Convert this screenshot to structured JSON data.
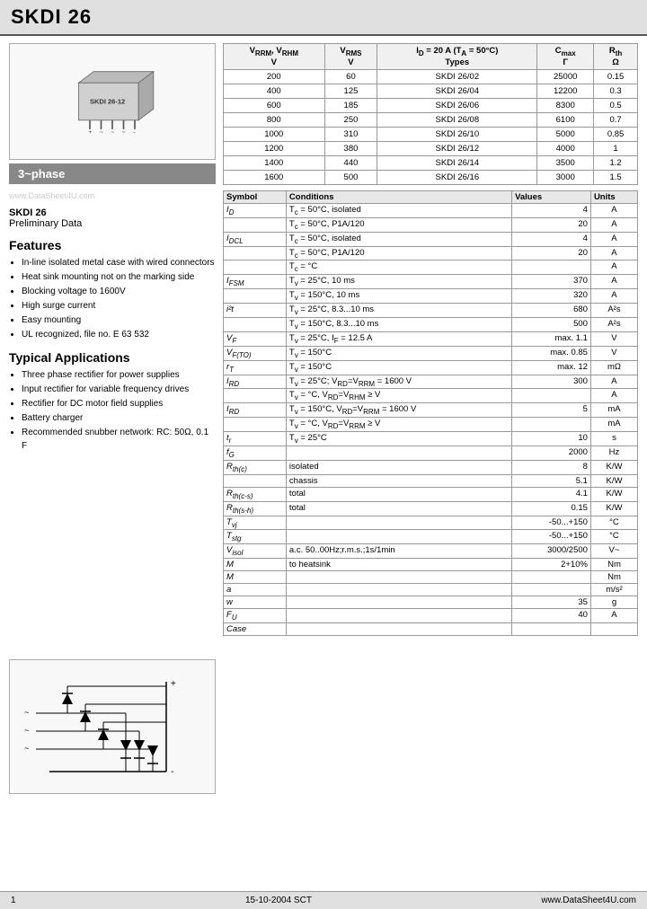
{
  "header": {
    "title": "SKDI 26"
  },
  "phase_label": "3~phase",
  "watermark": "www.DataSheet4U.com",
  "part_info": {
    "name": "SKDI 26",
    "status": "Preliminary Data"
  },
  "features": {
    "title": "Features",
    "items": [
      "In-line isolated metal case with wired connectors",
      "Heat sink mounting not on the marking side",
      "Blocking voltage to 1600V",
      "High surge current",
      "Easy mounting",
      "UL recognized, file no. E 63 532"
    ]
  },
  "applications": {
    "title": "Typical Applications",
    "items": [
      "Three phase rectifier for power supplies",
      "Input rectifier for variable frequency drives",
      "Rectifier for DC motor field supplies",
      "Battery charger",
      "Recommended snubber network: RC: 50Ω, 0.1 F"
    ]
  },
  "ratings_table": {
    "headers": [
      "V_RRM, V_RHM\nV",
      "V_RMS\nV",
      "I_D = 20 A (T_A = 50°C)\nTypes",
      "C_max\nΓ",
      "R_th\nΩ"
    ],
    "rows": [
      [
        "200",
        "60",
        "SKDI 26/02",
        "25000",
        "0.15"
      ],
      [
        "400",
        "125",
        "SKDI 26/04",
        "12200",
        "0.3"
      ],
      [
        "600",
        "185",
        "SKDI 26/06",
        "8300",
        "0.5"
      ],
      [
        "800",
        "250",
        "SKDI 26/08",
        "6100",
        "0.7"
      ],
      [
        "1000",
        "310",
        "SKDI 26/10",
        "5000",
        "0.85"
      ],
      [
        "1200",
        "380",
        "SKDI 26/12",
        "4000",
        "1"
      ],
      [
        "1400",
        "440",
        "SKDI 26/14",
        "3500",
        "1.2"
      ],
      [
        "1600",
        "500",
        "SKDI 26/16",
        "3000",
        "1.5"
      ]
    ]
  },
  "specs_table": {
    "headers": [
      "Symbol",
      "Conditions",
      "Values",
      "Units"
    ],
    "rows": [
      [
        "I_D",
        "T_c = 50°C, isolated",
        "4",
        "A"
      ],
      [
        "",
        "T_c = 50°C, P1A/120",
        "20",
        "A"
      ],
      [
        "I_DCL",
        "T_c = 50°C, isolated",
        "4",
        "A"
      ],
      [
        "",
        "T_c = 50°C, P1A/120",
        "20",
        "A"
      ],
      [
        "",
        "T_c = °C",
        "",
        "A"
      ],
      [
        "I_FSM",
        "T_v = 25°C, 10 ms",
        "370",
        "A"
      ],
      [
        "",
        "T_v = 150°C, 10 ms",
        "320",
        "A"
      ],
      [
        "i²t",
        "T_v = 25°C, 8.3...10 ms",
        "680",
        "A²s"
      ],
      [
        "",
        "T_v = 150°C, 8.3...10 ms",
        "500",
        "A²s"
      ],
      [
        "V_F",
        "T_v = 25°C, I_F = 12.5 A",
        "max. 1.1",
        "V"
      ],
      [
        "V_F(TO)",
        "T_v = 150°C",
        "max. 0.85",
        "V"
      ],
      [
        "r_T",
        "T_v = 150°C",
        "max. 12",
        "mΩ"
      ],
      [
        "I_RD",
        "T_v = 25°C; V_RD=V_RRM = 1600 V",
        "300",
        "A"
      ],
      [
        "",
        "T_v = °C, V_RD=V_RHM ≥ V",
        "",
        "A"
      ],
      [
        "I_RD",
        "T_v = 150°C, V_RD=V_RRM = 1600 V",
        "5",
        "mA"
      ],
      [
        "",
        "T_v = °C, V_RD=V_RRM ≥ V",
        "",
        "mA"
      ],
      [
        "t_r",
        "T_v = 25°C",
        "10",
        "s"
      ],
      [
        "f_G",
        "",
        "2000",
        "Hz"
      ],
      [
        "R_th(c)",
        "isolated",
        "8",
        "K/W"
      ],
      [
        "",
        "chassis",
        "5.1",
        "K/W"
      ],
      [
        "R_th(c-s)",
        "total",
        "4.1",
        "K/W"
      ],
      [
        "R_th(s-h)",
        "total",
        "0.15",
        "K/W"
      ],
      [
        "T_vj",
        "",
        "-50...+150",
        "°C"
      ],
      [
        "T_stg",
        "",
        "-50...+150",
        "°C"
      ],
      [
        "V_isol",
        "a.c. 50..00Hz;r.m.s.;1s/1min",
        "3000/2500",
        "V~"
      ],
      [
        "M",
        "to heatsink",
        "2+10%",
        "Nm"
      ],
      [
        "M",
        "",
        "",
        "Nm"
      ],
      [
        "a",
        "",
        "",
        "m/s²"
      ],
      [
        "w",
        "",
        "35",
        "g"
      ],
      [
        "F_U",
        "",
        "40",
        "A"
      ],
      [
        "Case",
        "",
        "",
        ""
      ]
    ]
  },
  "footer": {
    "page": "1",
    "date": "15-10-2004  SCT",
    "website": "www.DataSheet4U.com"
  }
}
